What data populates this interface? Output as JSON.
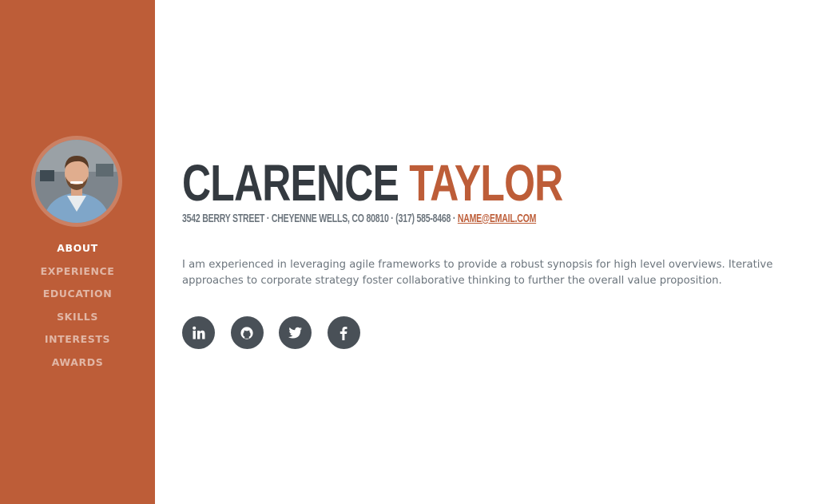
{
  "colors": {
    "primary": "#bd5d38",
    "heading": "#343a40",
    "muted": "#6c757d",
    "social_bg": "#495057"
  },
  "sidebar": {
    "avatar_alt": "profile photo",
    "nav": [
      {
        "label": "ABOUT",
        "active": true
      },
      {
        "label": "EXPERIENCE",
        "active": false
      },
      {
        "label": "EDUCATION",
        "active": false
      },
      {
        "label": "SKILLS",
        "active": false
      },
      {
        "label": "INTERESTS",
        "active": false
      },
      {
        "label": "AWARDS",
        "active": false
      }
    ]
  },
  "about": {
    "first_name": "CLARENCE",
    "last_name": "TAYLOR",
    "contact_text": "3542 BERRY STREET · CHEYENNE WELLS, CO 80810 · (317) 585-8468 · ",
    "email": "NAME@EMAIL.COM",
    "lead": "I am experienced in leveraging agile frameworks to provide a robust synopsis for high level overviews. Iterative approaches to corporate strategy foster collaborative thinking to further the overall value proposition."
  },
  "social": [
    {
      "icon": "linkedin-icon"
    },
    {
      "icon": "github-icon"
    },
    {
      "icon": "twitter-icon"
    },
    {
      "icon": "facebook-icon"
    }
  ]
}
